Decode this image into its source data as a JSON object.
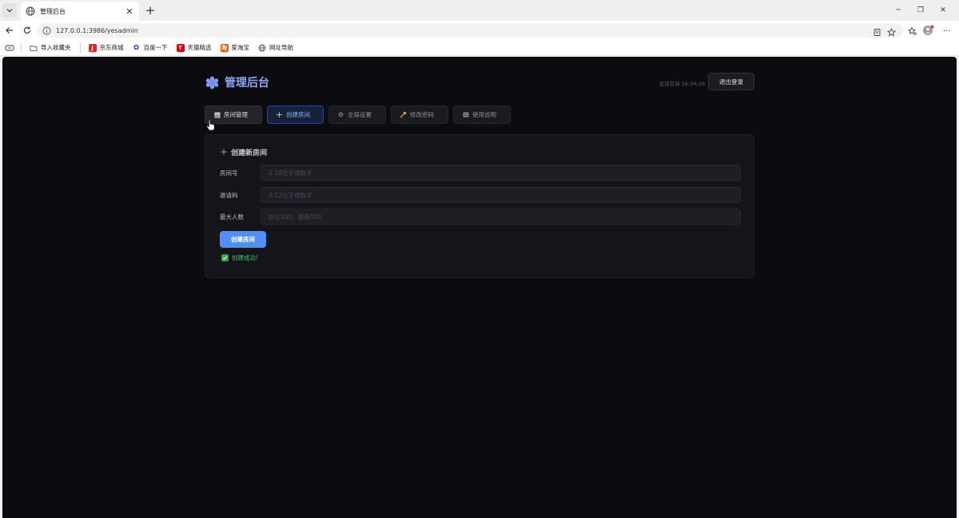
{
  "browser": {
    "tab_title": "管理后台",
    "url": "127.0.0.1:3986/yesadmin",
    "bookmarks": [
      {
        "label": "导入收藏夹",
        "icon": "folder-icon"
      },
      {
        "label": "京东商城",
        "icon": "jd-icon",
        "color": "#e1251b"
      },
      {
        "label": "百度一下",
        "icon": "baidu-icon",
        "color": "#2932e1"
      },
      {
        "label": "天猫精选",
        "icon": "tmall-icon",
        "color": "#d5000f"
      },
      {
        "label": "爱淘宝",
        "icon": "taobao-icon",
        "color": "#ff5000"
      },
      {
        "label": "网址导航",
        "icon": "globe-icon"
      }
    ]
  },
  "header": {
    "brand": "管理后台",
    "session": "会话有效 16:34:29",
    "logout_label": "退出登录"
  },
  "nav": {
    "tabs": [
      {
        "label": "房间管理",
        "icon": "chart-icon"
      },
      {
        "label": "创建房间",
        "icon": "plus-icon",
        "active": true
      },
      {
        "label": "全局设置",
        "icon": "gear-icon"
      },
      {
        "label": "修改密码",
        "icon": "key-icon"
      },
      {
        "label": "使用说明",
        "icon": "doc-icon"
      }
    ]
  },
  "form": {
    "title": "创建新房间",
    "fields": [
      {
        "label": "房间号",
        "placeholder": "2-20位字母数字"
      },
      {
        "label": "邀请码",
        "placeholder": "4-12位字母数字"
      },
      {
        "label": "最大人数",
        "placeholder": "默认100，最高500"
      }
    ],
    "submit_label": "创建房间",
    "success_message": "创建成功!"
  },
  "colors": {
    "accent": "#4f8ff7",
    "brand": "#8ba6f5",
    "success": "#37c56f",
    "background": "#0c0c10"
  }
}
